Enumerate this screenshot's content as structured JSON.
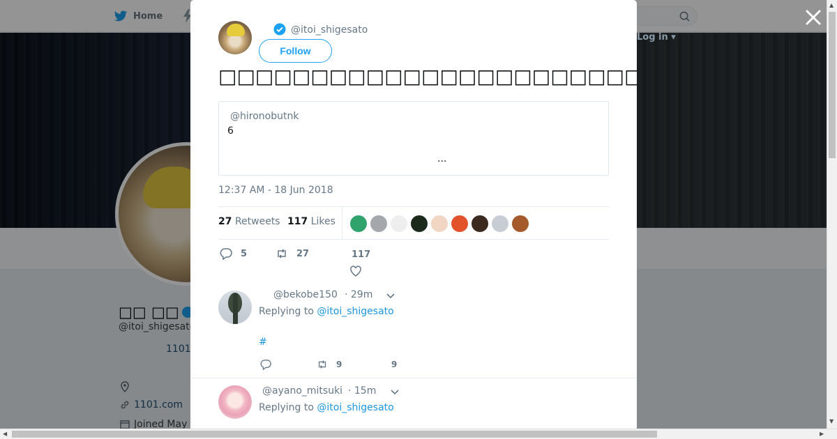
{
  "nav": {
    "home_label": "Home",
    "login_label": "Log in ▾"
  },
  "profile": {
    "name": "□□ □□",
    "handle": "@itoi_shigesato",
    "url_truncated": "1101",
    "website": "1101.com",
    "joined": "Joined May"
  },
  "tweet": {
    "author_handle": "@itoi_shigesato",
    "follow_label": "Follow",
    "text": "□□□□□□□□□□□□□□□□□□□□□□□□□□□□□□□□□□□□□□□□□□□□□□□□□□□□□□□□□□□□□□□□",
    "quote": {
      "handle": "@hironobutnk",
      "text": "6",
      "more": "..."
    },
    "time": "12:37 AM - 18 Jun 2018",
    "retweets_count": "27",
    "retweets_label": "Retweets",
    "likes_count": "117",
    "likes_label": "Likes",
    "actions": {
      "replies": "5",
      "retweets": "27",
      "likes": "117"
    },
    "liker_colors": [
      "#2fa36b",
      "#a4a8ad",
      "#eeeeee",
      "#1c2a1c",
      "#f1d6c4",
      "#e2532c",
      "#3b2a1d",
      "#c8cdd3",
      "#a45a2a"
    ]
  },
  "replies": [
    {
      "handle": "@bekobe150",
      "time": "· 29m",
      "replying_label": "Replying to",
      "replying_to": "@itoi_shigesato",
      "hashtag": "#",
      "retweets": "9",
      "likes": "9"
    },
    {
      "handle": "@ayano_mitsuki",
      "time": "· 15m",
      "replying_label": "Replying to",
      "replying_to": "@itoi_shigesato"
    }
  ]
}
